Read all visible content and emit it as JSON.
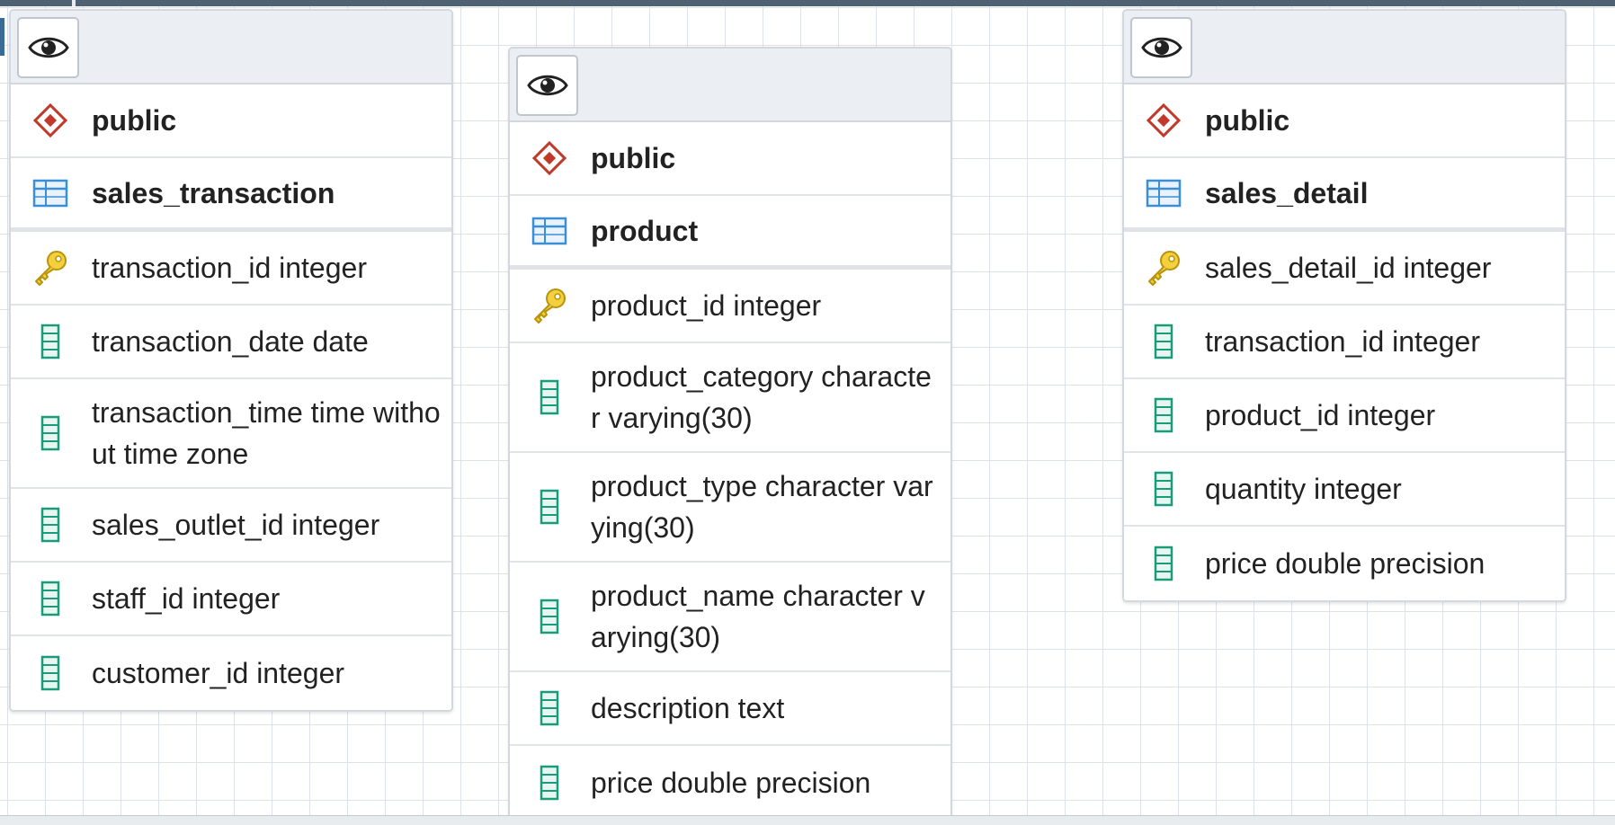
{
  "tables": [
    {
      "schema": "public",
      "name": "sales_transaction",
      "columns": [
        {
          "text": "transaction_id integer",
          "key": true
        },
        {
          "text": "transaction_date date",
          "key": false
        },
        {
          "text": "transaction_time time without time zone",
          "key": false
        },
        {
          "text": "sales_outlet_id integer",
          "key": false
        },
        {
          "text": "staff_id integer",
          "key": false
        },
        {
          "text": "customer_id integer",
          "key": false
        }
      ]
    },
    {
      "schema": "public",
      "name": "product",
      "columns": [
        {
          "text": "product_id integer",
          "key": true
        },
        {
          "text": "product_category character varying(30)",
          "key": false
        },
        {
          "text": "product_type character varying(30)",
          "key": false
        },
        {
          "text": "product_name character varying(30)",
          "key": false
        },
        {
          "text": "description text",
          "key": false
        },
        {
          "text": "price double precision",
          "key": false
        }
      ]
    },
    {
      "schema": "public",
      "name": "sales_detail",
      "columns": [
        {
          "text": "sales_detail_id integer",
          "key": true
        },
        {
          "text": "transaction_id integer",
          "key": false
        },
        {
          "text": "product_id integer",
          "key": false
        },
        {
          "text": "quantity integer",
          "key": false
        },
        {
          "text": "price double precision",
          "key": false
        }
      ]
    }
  ],
  "icons": {
    "header": "eye-icon",
    "schema": "schema-icon",
    "table": "table-icon",
    "primary_key": "key-icon",
    "column": "column-icon"
  },
  "colors": {
    "schema_icon": "#c0392b",
    "table_icon": "#3a8fd6",
    "key_icon": "#e0b800",
    "column_icon": "#1a9b7b"
  }
}
